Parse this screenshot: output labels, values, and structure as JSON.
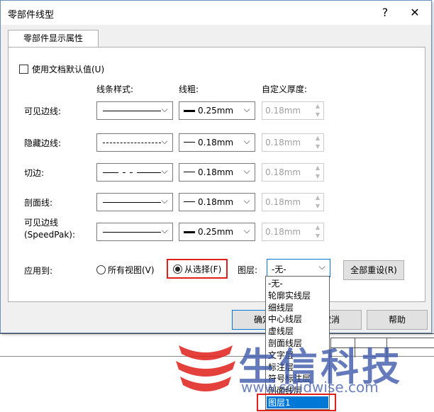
{
  "window": {
    "title": "零部件线型",
    "help_glyph": "?",
    "close_glyph": "✕"
  },
  "tab": {
    "label": "零部件显示属性"
  },
  "use_defaults": {
    "label": "使用文档默认值(U)"
  },
  "columns": {
    "style": "线条样式:",
    "weight": "线粗:",
    "thickness": "自定义厚度:"
  },
  "rows": [
    {
      "label": "可见边线:",
      "style": "solid",
      "weight": "0.25mm",
      "thickness": "0.18mm"
    },
    {
      "label": "隐藏边线:",
      "style": "dashed",
      "weight": "0.18mm",
      "thickness": "0.18mm"
    },
    {
      "label": "切边:",
      "style": "dashdot",
      "weight": "0.18mm",
      "thickness": "0.18mm"
    },
    {
      "label": "剖面线:",
      "style": "solid",
      "weight": "0.18mm",
      "thickness": "0.18mm"
    },
    {
      "label": "可见边线\n(SpeedPak):",
      "style": "solid",
      "weight": "0.25mm",
      "thickness": "0.18mm"
    }
  ],
  "apply": {
    "label": "应用到:",
    "all_views": "所有视图(V)",
    "from_selection": "从选择(F)",
    "layer_label": "图层:",
    "layer_value": "-无-",
    "reset_all": "全部重设(R)"
  },
  "buttons": {
    "ok": "确定",
    "cancel": "取消",
    "help": "帮助"
  },
  "layer_options": [
    "-无-",
    "轮廓实线层",
    "细线层",
    "中心线层",
    "虚线层",
    "剖面线层",
    "文字层",
    "标注层",
    "符号标注层",
    "剖面线层",
    "图层1"
  ],
  "watermark": {
    "brand": "生信科技",
    "url": "www.solidwise.com"
  },
  "colors": {
    "accent": "#0078d7",
    "highlight": "#e0201a"
  }
}
